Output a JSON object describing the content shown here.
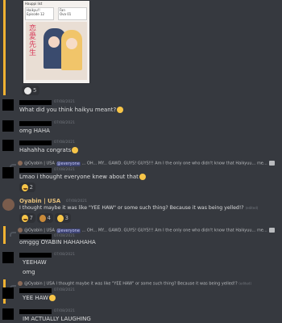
{
  "embed": {
    "header": "Hauppi list",
    "card1": {
      "name": "Haikyu!!",
      "stat": "Episode 12"
    },
    "card2": {
      "name": "Fan",
      "stat": "Ova 01"
    },
    "cover_title": "恋愛先生",
    "reaction_count": "5"
  },
  "messages": [
    {
      "time": "07/08/2021",
      "text": "What did you think haikyu meant?"
    },
    {
      "time": "07/08/2021",
      "text": "omg HAHA"
    },
    {
      "time": "07/08/2021",
      "text": "Hahahha congrats"
    },
    {
      "reply": {
        "author": "@Oyabin | USA",
        "mention": "@everyone",
        "text": " ... OH... MY... GAWD. GUYS! GUYS!!! Am I the only one who didn't know that Haikyuu... me..."
      },
      "time": "07/08/2021",
      "text": "Lmao i thought everyone knew about that",
      "reaction_count": "2"
    }
  ],
  "post": {
    "username": "Oyabin | USA",
    "time": "07/08/2021",
    "text": "I thought maybe it was like \"YEE HAW\" or some such thing? Because it was being yelled!?",
    "edited": "(edited)",
    "reactions": [
      {
        "count": "7"
      },
      {
        "count": "4"
      },
      {
        "count": "3"
      }
    ]
  },
  "replies": [
    {
      "reply": {
        "author": "@Oyabin | USA",
        "mention": "@everyone",
        "text": " ... OH... MY... GAWD. GUYS! GUYS!!! Am I the only one who didn't know that Haikyuu... me..."
      },
      "time": "07/08/2021",
      "text": "omggg OYABIN HAHAHAHA"
    },
    {
      "time": "07/08/2021",
      "text": "YEEHAW"
    },
    {
      "text": "omg"
    },
    {
      "reply": {
        "author": "@Oyabin | USA",
        "text": " I thought maybe it was like \"YEE HAW\" or some such thing? Because it was being yelled!?",
        "edited": "(edited)"
      },
      "time": "07/08/2021",
      "text": "YEE HAW"
    },
    {
      "time": "07/08/2021",
      "text": "IM ACTUALLY LAUGHING"
    }
  ]
}
